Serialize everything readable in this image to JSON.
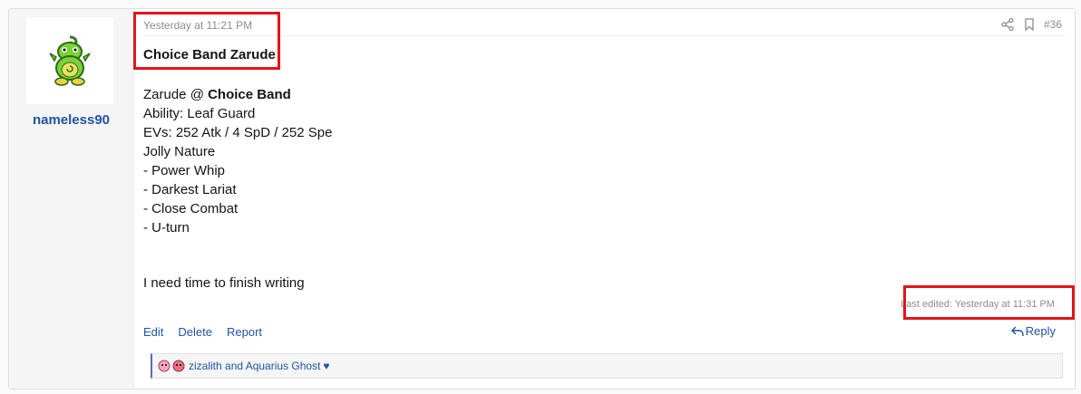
{
  "user": {
    "name": "nameless90",
    "avatar_icon": "politoed-sprite-icon"
  },
  "post": {
    "timestamp": "Yesterday at 11:21 PM",
    "number": "#36",
    "title": "Choice Band Zarude",
    "set_line_prefix": "Zarude @ ",
    "set_item": "Choice Band",
    "lines": [
      "Ability: Leaf Guard",
      "EVs: 252 Atk / 4 SpD / 252 Spe",
      "Jolly Nature",
      "- Power Whip",
      "- Darkest Lariat",
      "- Close Combat",
      "- U-turn"
    ],
    "closing": "I need time to finish writing",
    "edited": "Last edited: Yesterday at 11:31 PM"
  },
  "actions": {
    "edit": "Edit",
    "delete": "Delete",
    "report": "Report",
    "reply": "Reply"
  },
  "reactions": {
    "text": "zizalith and Aquarius Ghost",
    "heart": "♥"
  },
  "colors": {
    "link": "#1f54a4",
    "highlight": "#e3141b",
    "muted": "#8c8c8c"
  }
}
